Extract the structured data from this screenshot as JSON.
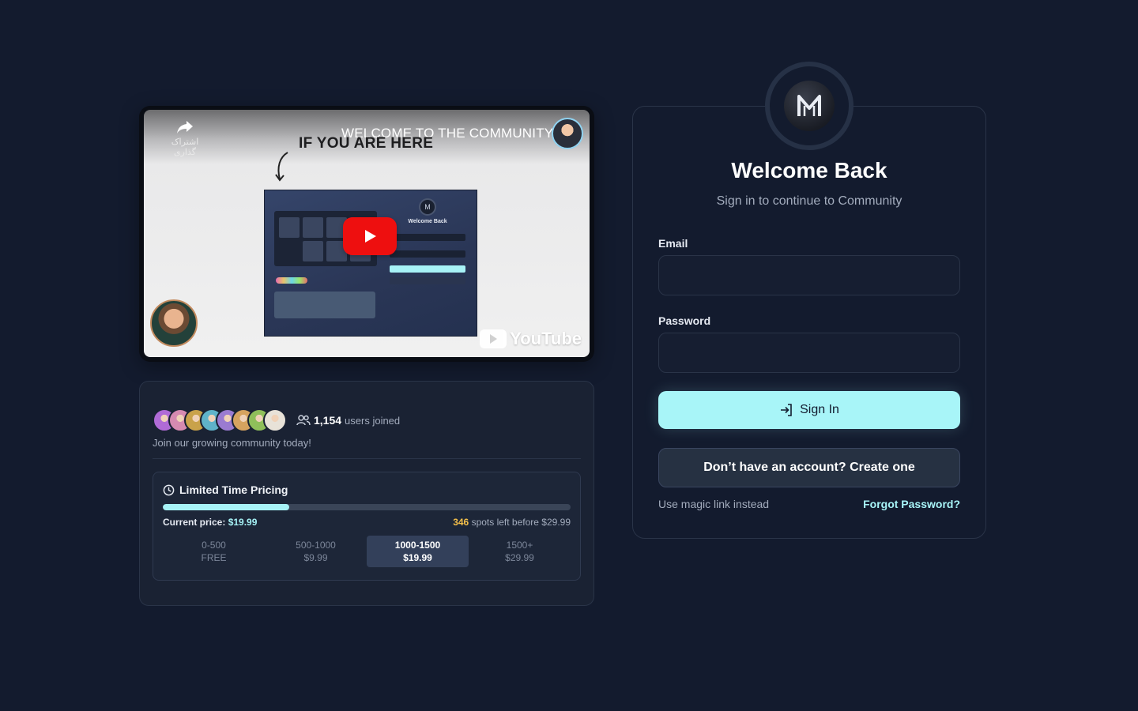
{
  "video": {
    "title": "WELCOME TO THE COMMUNITY",
    "overlay_text": "IF YOU ARE HERE",
    "share_label": "اشتراک گذاری",
    "thumbnail_title": "Welcome Back",
    "platform": "YouTube",
    "icons": [
      "share-icon",
      "play-icon",
      "youtube-icon"
    ]
  },
  "community": {
    "joined_count": "1,154",
    "joined_label": "users joined",
    "join_text": "Join our growing community today!",
    "avatar_colors": [
      "#b06bd6",
      "#d68ab0",
      "#c9a24a",
      "#5fb3c9",
      "#9a7bd1",
      "#d6a35f",
      "#8fbf5a",
      "#e8e2d8"
    ]
  },
  "pricing": {
    "heading": "Limited Time Pricing",
    "progress_fraction": 0.31,
    "current_price_label": "Current price:",
    "current_price_value": "$19.99",
    "spots_left": "346",
    "spots_text": "spots left before $29.99",
    "tiers": [
      {
        "range": "0-500",
        "price": "FREE",
        "active": false
      },
      {
        "range": "500-1000",
        "price": "$9.99",
        "active": false
      },
      {
        "range": "1000-1500",
        "price": "$19.99",
        "active": true
      },
      {
        "range": "1500+",
        "price": "$29.99",
        "active": false
      }
    ]
  },
  "login": {
    "logo_letter": "M",
    "title": "Welcome Back",
    "subtitle": "Sign in to continue to Community",
    "email_label": "Email",
    "email_value": "",
    "password_label": "Password",
    "password_value": "",
    "signin_label": "Sign In",
    "create_label": "Don’t have an account? Create one",
    "magic_link": "Use magic link instead",
    "forgot": "Forgot Password?"
  },
  "colors": {
    "background": "#131b2e",
    "accent": "#a8f5f8",
    "highlight": "#f5c04a",
    "youtube_red": "#ee0f0f"
  }
}
